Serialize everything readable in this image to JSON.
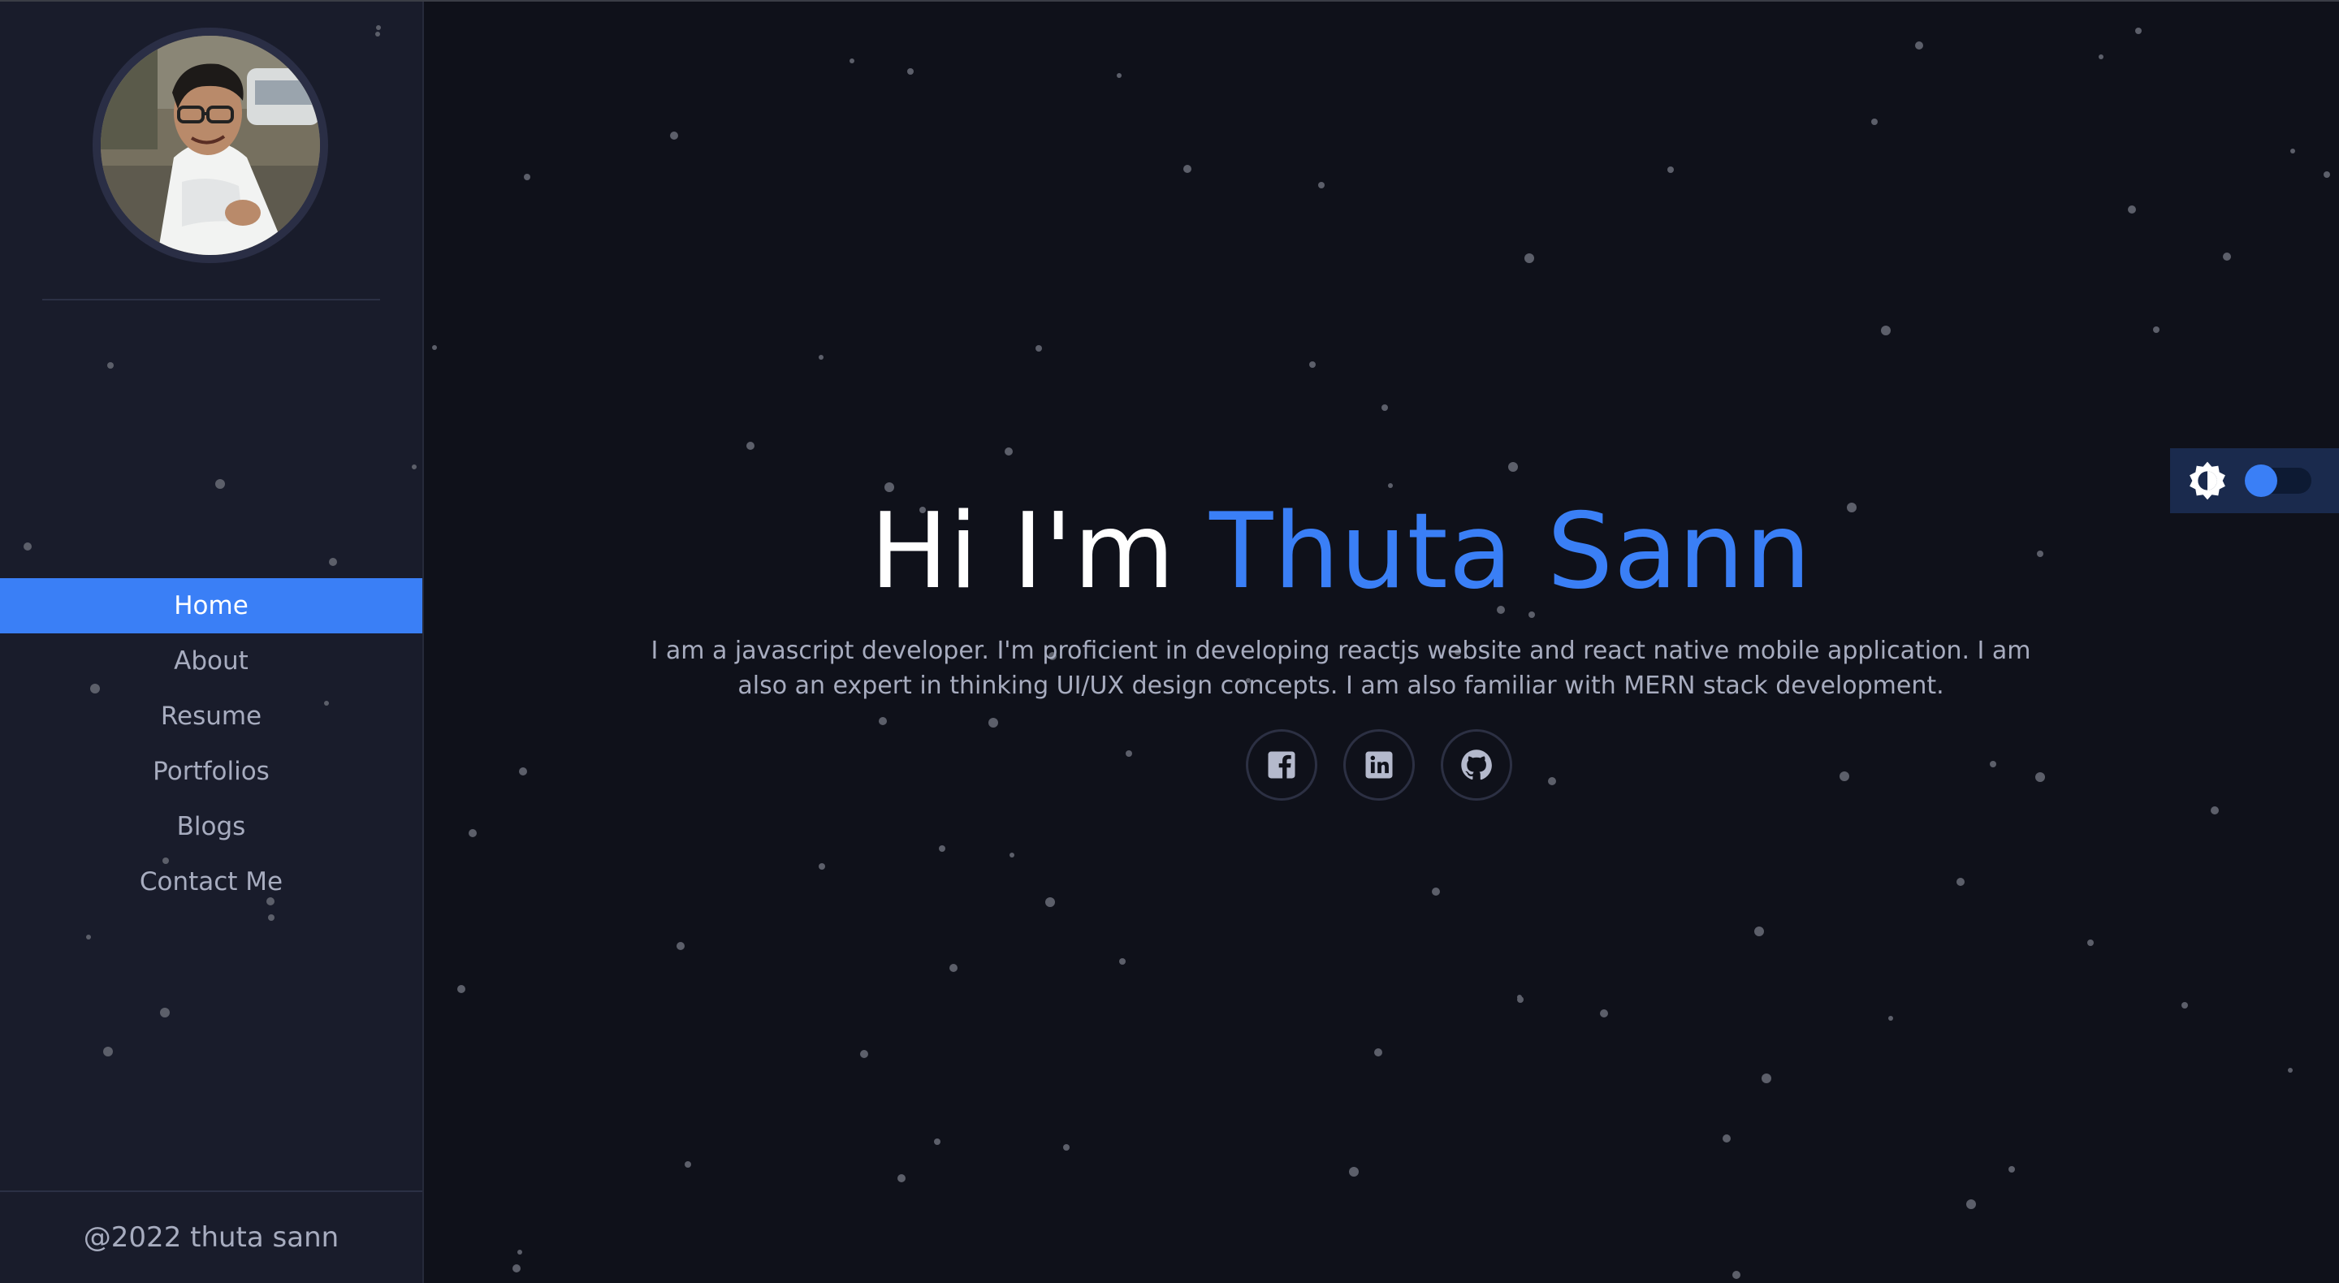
{
  "sidebar": {
    "nav": [
      {
        "label": "Home",
        "active": true
      },
      {
        "label": "About",
        "active": false
      },
      {
        "label": "Resume",
        "active": false
      },
      {
        "label": "Portfolios",
        "active": false
      },
      {
        "label": "Blogs",
        "active": false
      },
      {
        "label": "Contact Me",
        "active": false
      }
    ],
    "footer": "@2022 thuta sann"
  },
  "hero": {
    "greeting": "Hi I'm ",
    "name": "Thuta Sann",
    "bio": "I am a javascript developer. I'm proficient in developing reactjs website and react native mobile application. I am also an expert in thinking UI/UX design concepts. I am also familiar with MERN stack development."
  },
  "socials": [
    {
      "icon": "facebook-icon"
    },
    {
      "icon": "linkedin-icon"
    },
    {
      "icon": "github-icon"
    }
  ],
  "theme_toggle": {
    "icon": "brightness-icon",
    "dark_mode": true
  },
  "colors": {
    "accent": "#3a7ff6",
    "background": "#0f111a",
    "sidebar": "#191c2b",
    "text": "#a7acbf"
  }
}
